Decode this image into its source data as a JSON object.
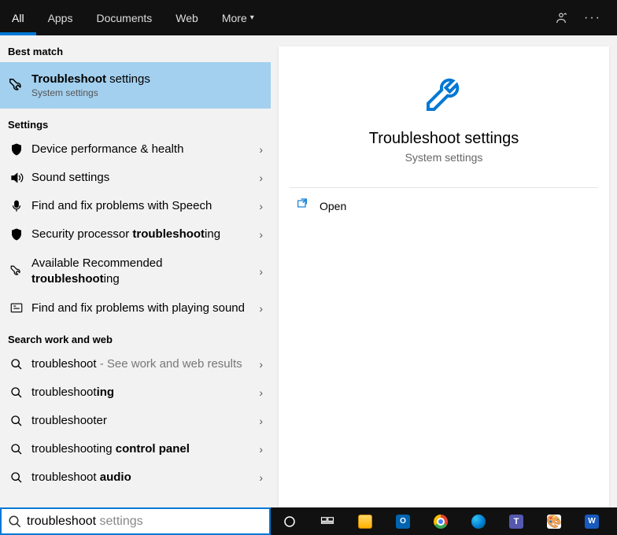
{
  "tabs": {
    "all": "All",
    "apps": "Apps",
    "docs": "Documents",
    "web": "Web",
    "more": "More"
  },
  "sections": {
    "best": "Best match",
    "settings": "Settings",
    "searchweb": "Search work and web"
  },
  "best_match": {
    "title_a": "Troubleshoot",
    "title_b": " settings",
    "sub": "System settings"
  },
  "settings_items": {
    "i0": "Device performance & health",
    "i1": "Sound settings",
    "i2": "Find and fix problems with Speech",
    "i3_a": "Security processor ",
    "i3_b": "troubleshoot",
    "i3_c": "ing",
    "i4_a": "Available Recommended ",
    "i4_b": "troubleshoot",
    "i4_c": "ing",
    "i5": "Find and fix problems with playing sound"
  },
  "web_items": {
    "w0_a": "troubleshoot",
    "w0_b": " - See work and web results",
    "w1_a": "troubleshoot",
    "w1_b": "ing",
    "w2": "troubleshooter",
    "w3_a": "troubleshoot",
    "w3_b": "ing ",
    "w3_c": "control panel",
    "w4_a": "troubleshoot ",
    "w4_b": "audio"
  },
  "preview": {
    "title": "Troubleshoot settings",
    "type": "System settings",
    "open": "Open"
  },
  "search": {
    "typed": "troubleshoot",
    "ghost": " settings"
  }
}
